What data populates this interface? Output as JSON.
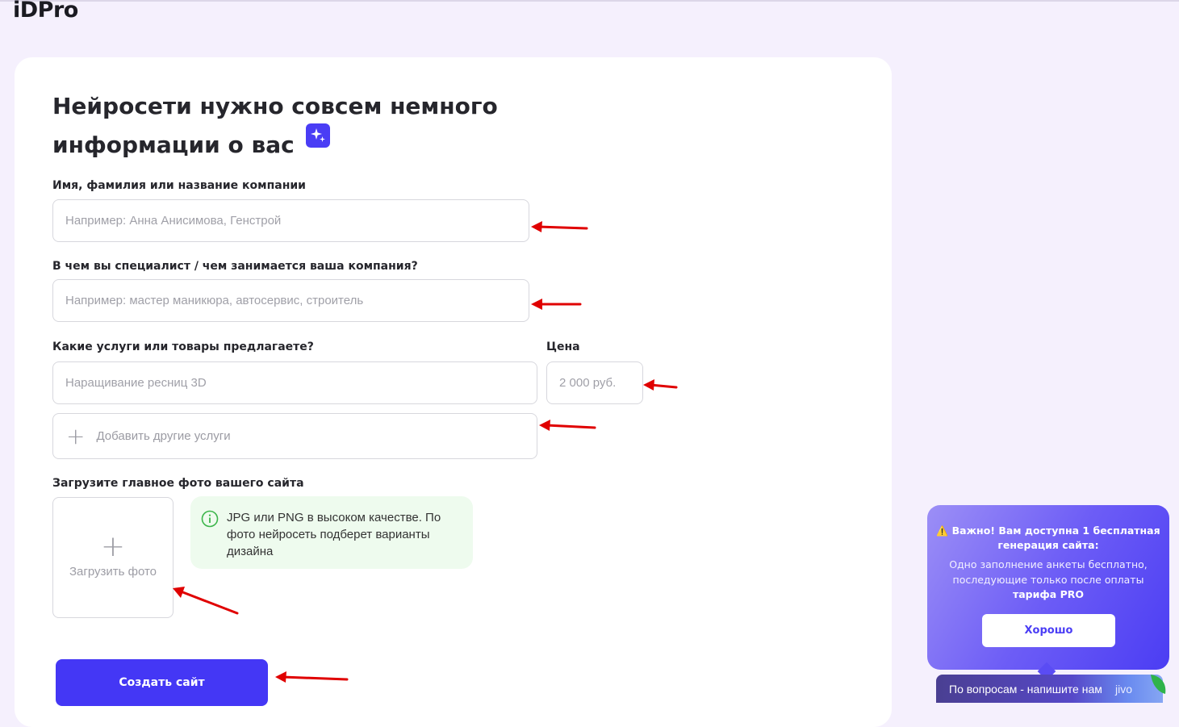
{
  "header": {
    "logo": "iDPro"
  },
  "form": {
    "title_line1": "Нейросети нужно совсем немного",
    "title_line2": "информации о вас",
    "name": {
      "label": "Имя, фамилия или название компании",
      "placeholder": "Например: Анна Анисимова, Генстрой"
    },
    "specialty": {
      "label": "В чем вы специалист / чем занимается ваша компания?",
      "placeholder": "Например: мастер маникюра, автосервис, строитель"
    },
    "services": {
      "label": "Какие услуги или товары предлагаете?",
      "placeholder": "Наращивание ресниц 3D"
    },
    "price": {
      "label": "Цена",
      "placeholder": "2 000 руб."
    },
    "add_services_label": "Добавить другие услуги",
    "photo": {
      "label": "Загрузите главное фото вашего сайта",
      "upload_label": "Загрузить фото",
      "hint": "JPG или PNG в высоком качестве. По фото нейросеть подберет варианты дизайна"
    },
    "submit_label": "Создать сайт"
  },
  "popup": {
    "warning_icon": "⚠️",
    "title": "Важно! Вам доступна 1 бесплатная генерация сайта:",
    "body_prefix": "Одно заполнение анкеты бесплатно, последующие только после оплаты ",
    "body_bold": "тарифа PRO",
    "ok_label": "Хорошо"
  },
  "chat": {
    "label": "По вопросам - напишите нам",
    "brand": "jivo"
  },
  "colors": {
    "accent": "#4437f5",
    "background": "#f5f0fd",
    "hint_bg": "#eefbee",
    "hint_icon": "#3bb54a",
    "annotation_arrow": "#e00000"
  }
}
